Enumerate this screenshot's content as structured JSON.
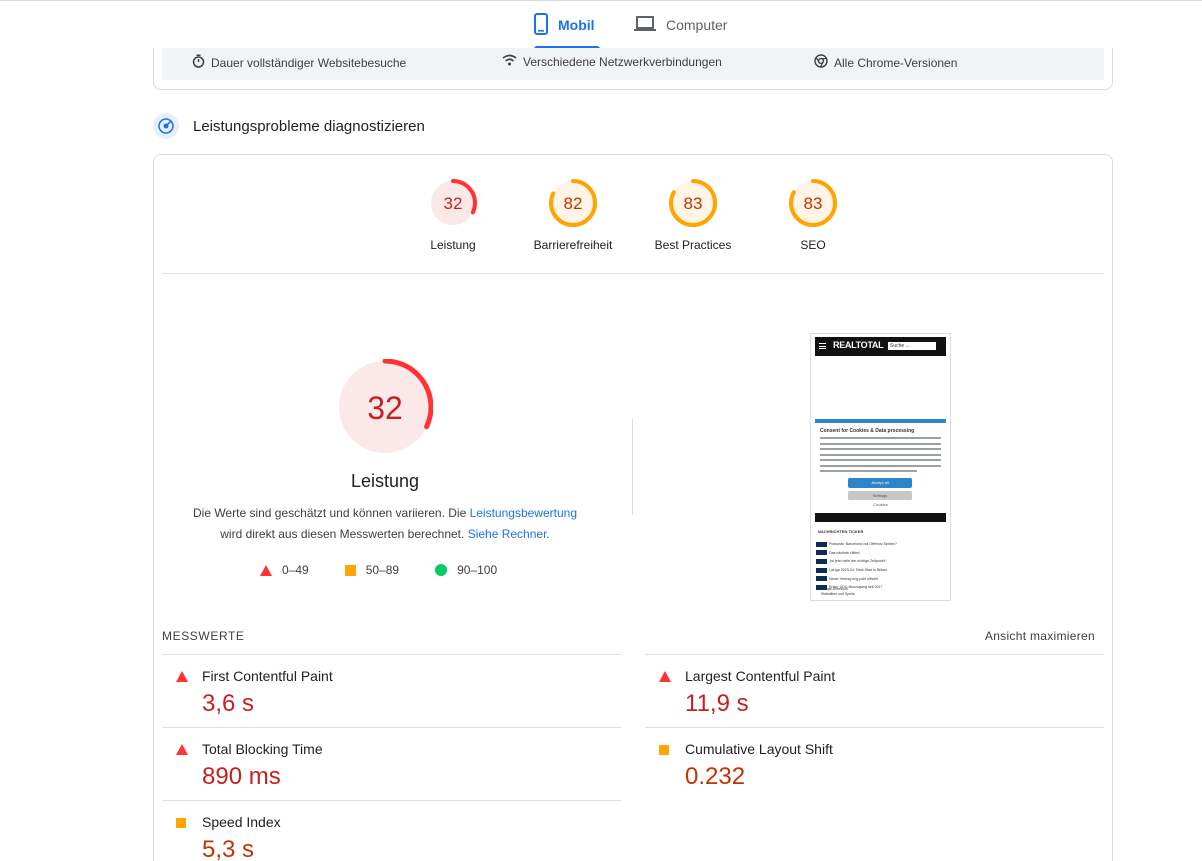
{
  "tabs": [
    {
      "label": "Mobil",
      "icon": "smartphone-icon",
      "active": true
    },
    {
      "label": "Computer",
      "icon": "laptop-icon",
      "active": false
    }
  ],
  "top_strip": [
    {
      "label": "Dauer vollständiger Websitebesuche",
      "icon": "timer-icon"
    },
    {
      "label": "Verschiedene Netzwerkverbindungen",
      "icon": "network-icon"
    },
    {
      "label": "Alle Chrome-Versionen",
      "icon": "chrome-icon"
    }
  ],
  "section": {
    "title": "Leistungsprobleme diagnostizieren",
    "icon": "lighthouse-icon"
  },
  "categories": [
    {
      "score": "32",
      "fraction": 0.32,
      "label": "Leistung",
      "status": "fail"
    },
    {
      "score": "82",
      "fraction": 0.82,
      "label": "Barrierefreiheit",
      "status": "average"
    },
    {
      "score": "83",
      "fraction": 0.83,
      "label": "Best Practices",
      "status": "average"
    },
    {
      "score": "83",
      "fraction": 0.83,
      "label": "SEO",
      "status": "average"
    }
  ],
  "performance": {
    "score": "32",
    "fraction": 0.32,
    "title": "Leistung",
    "desc_part1": "Die Werte sind geschätzt und können variieren. Die ",
    "desc_link1": "Leistungsbewertung",
    "desc_part2": "wird direkt aus diesen Messwerten berechnet. ",
    "desc_link2": "Siehe Rechner",
    "desc_end": "."
  },
  "legend": [
    {
      "shape": "triangle",
      "range": "0–49",
      "color": "#ff3333"
    },
    {
      "shape": "square",
      "range": "50–89",
      "color": "#ffa400"
    },
    {
      "shape": "circle",
      "range": "90–100",
      "color": "#00cc66"
    }
  ],
  "screenshot": {
    "logo": "REALTOTAL",
    "search_placeholder": "Suche ...",
    "consent_title": "Consent for Cookies & Data processing",
    "accept_label": "Accept all",
    "settings_label": "Settings",
    "cookies_label": "Cookies",
    "ticker_title": "NACHRICHTEN TICKER",
    "news": [
      "Podcasts: Barcelona voll Offensiv-Spieler?",
      "Das nächste Hilfes!",
      "„Ist jetzt nicht der richtige Zeitpunkt“",
      "LaLiga 2023-24: Real-Start in Bilbao",
      "Neuer Vertrag eng pobl offiziell",
      "Erster UDC-Neuzugang seit 2017"
    ],
    "footer_lines": [
      "7-Tage-Übersicht",
      "Statistiken und Spiele"
    ]
  },
  "metrics": {
    "heading": "MESSWERTE",
    "expand_label": "Ansicht maximieren",
    "items": [
      {
        "name": "First Contentful Paint",
        "value": "3,6 s",
        "status": "fail"
      },
      {
        "name": "Largest Contentful Paint",
        "value": "11,9 s",
        "status": "fail"
      },
      {
        "name": "Total Blocking Time",
        "value": "890 ms",
        "status": "fail"
      },
      {
        "name": "Cumulative Layout Shift",
        "value": "0.232",
        "status": "average"
      },
      {
        "name": "Speed Index",
        "value": "5,3 s",
        "status": "average"
      }
    ]
  },
  "colors": {
    "fail": "#ff3333",
    "average": "#ffa400",
    "pass": "#00cc66",
    "accent": "#1a73e8"
  }
}
